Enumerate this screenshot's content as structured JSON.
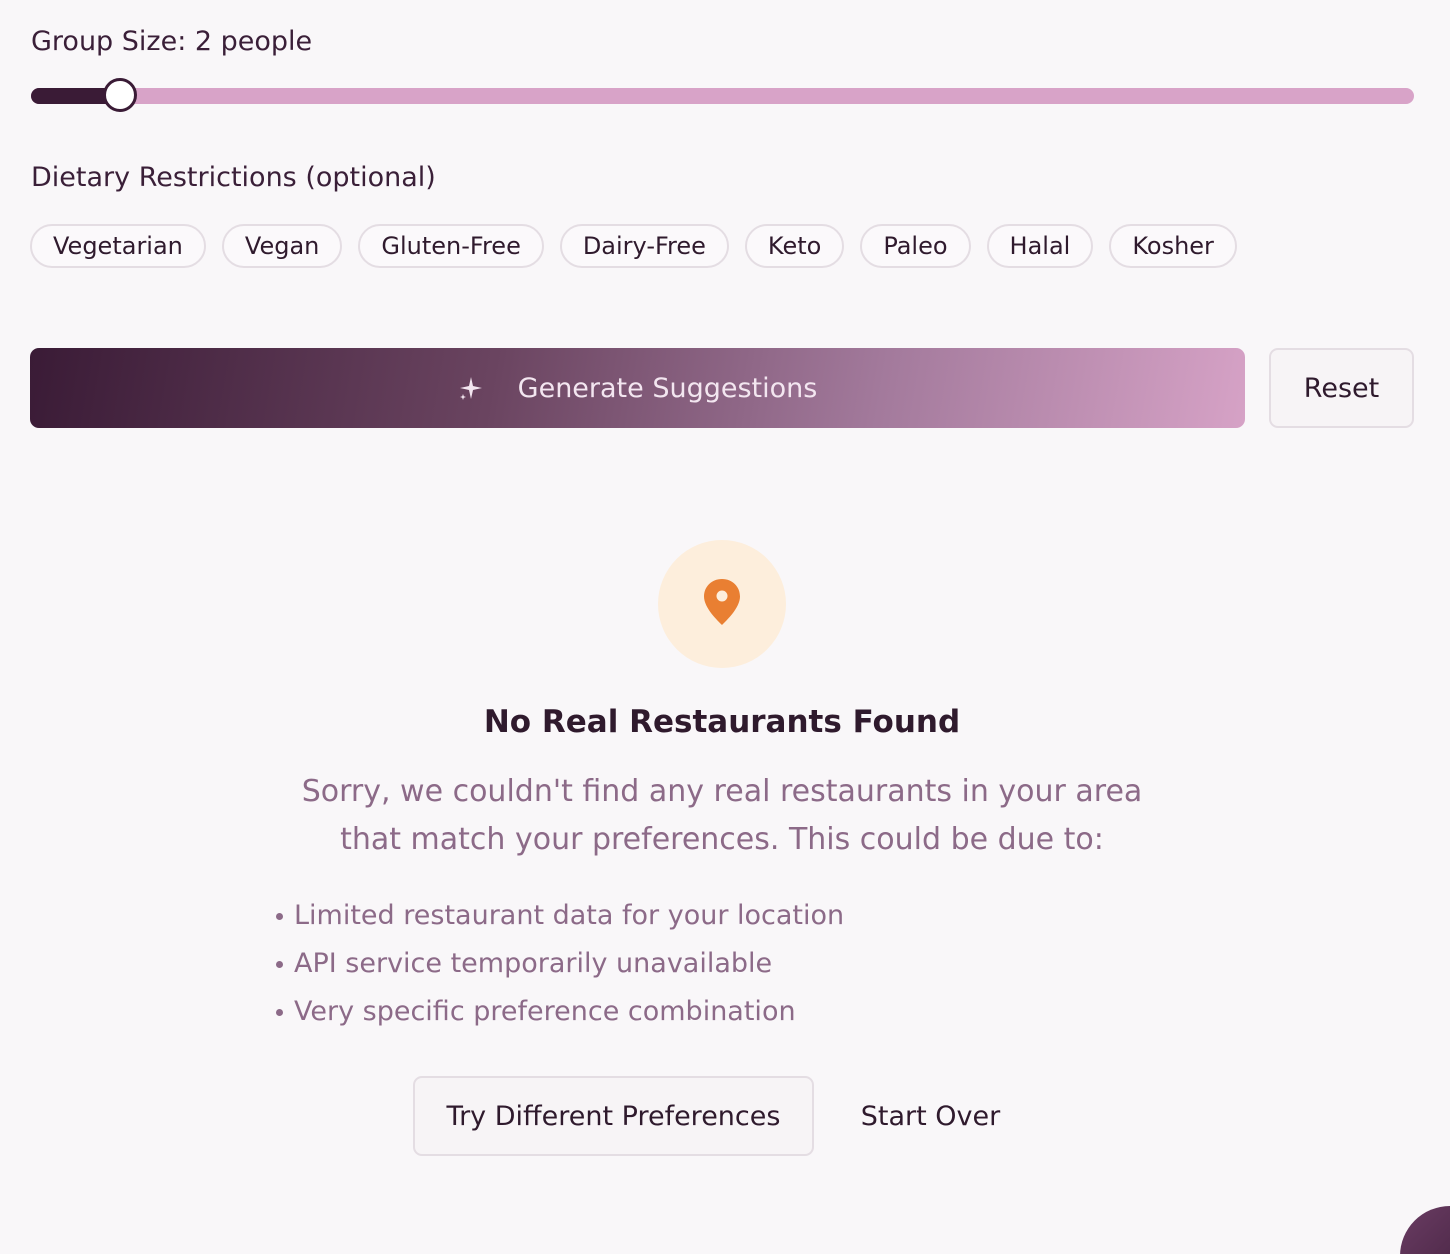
{
  "group_size": {
    "label": "Group Size: 2 people",
    "slider": {
      "value": 2,
      "fill_fraction": 0.065
    }
  },
  "dietary": {
    "label": "Dietary Restrictions (optional)",
    "options": [
      "Vegetarian",
      "Vegan",
      "Gluten-Free",
      "Dairy-Free",
      "Keto",
      "Paleo",
      "Halal",
      "Kosher"
    ]
  },
  "actions": {
    "generate_label": "Generate Suggestions",
    "generate_icon": "sparkles-icon",
    "reset_label": "Reset"
  },
  "empty_state": {
    "icon": "map-pin-icon",
    "title": "No Real Restaurants Found",
    "description": "Sorry, we couldn't find any real restaurants in your area that match your preferences. This could be due to:",
    "reasons": [
      "Limited restaurant data for your location",
      "API service temporarily unavailable",
      "Very specific preference combination"
    ],
    "primary_label": "Try Different Preferences",
    "secondary_label": "Start Over"
  },
  "colors": {
    "accent_dark": "#3a1b36",
    "accent_light": "#d6a2c6",
    "pin_orange": "#e97f32",
    "pin_bg": "#fdeedc",
    "muted_text": "#8c6a88"
  }
}
